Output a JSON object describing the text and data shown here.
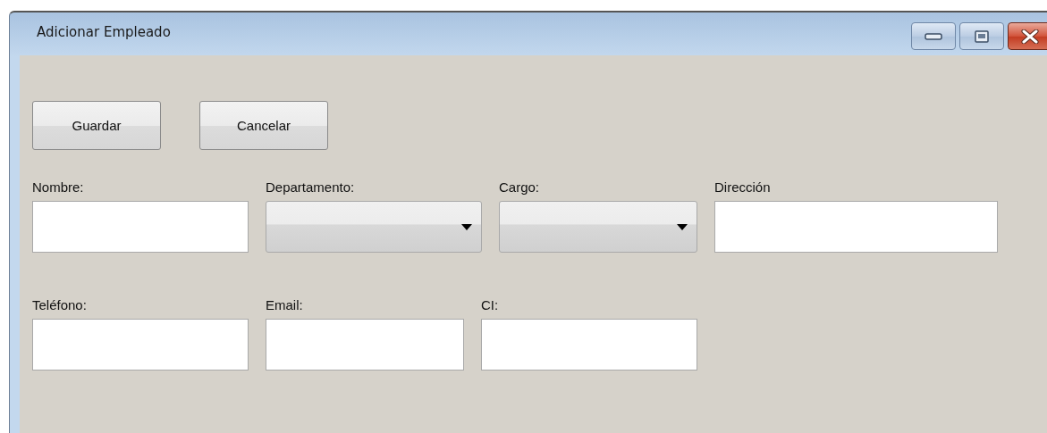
{
  "window": {
    "title": "Adicionar Empleado"
  },
  "buttons": [
    {
      "label": "Guardar"
    },
    {
      "label": "Cancelar"
    }
  ],
  "rows": [
    {
      "fields": [
        {
          "label": "Nombre:",
          "kind": "text"
        },
        {
          "label": "Departamento:",
          "kind": "dropdown"
        },
        {
          "label": "Cargo:",
          "kind": "dropdown"
        },
        {
          "label": "Dirección",
          "kind": "text"
        }
      ]
    },
    {
      "fields": [
        {
          "label": "Teléfono:",
          "kind": "text"
        },
        {
          "label": "Email:",
          "kind": "text"
        },
        {
          "label": "CI:",
          "kind": "text"
        }
      ]
    }
  ]
}
